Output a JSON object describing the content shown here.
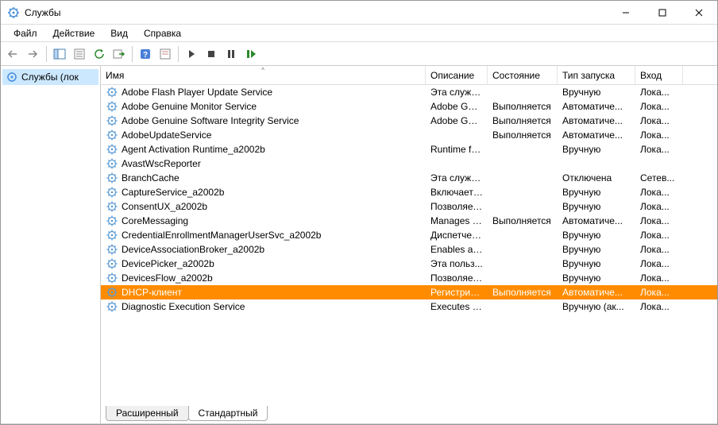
{
  "window": {
    "title": "Службы"
  },
  "menu": {
    "file": "Файл",
    "action": "Действие",
    "view": "Вид",
    "help": "Справка"
  },
  "tree": {
    "root": "Службы (лок"
  },
  "columns": {
    "name": "Имя",
    "description": "Описание",
    "state": "Состояние",
    "startup": "Тип запуска",
    "logon": "Вход "
  },
  "tabs": {
    "extended": "Расширенный",
    "standard": "Стандартный"
  },
  "services": [
    {
      "name": "Adobe Flash Player Update Service",
      "desc": "Эта служб...",
      "state": "",
      "startup": "Вручную",
      "logon": "Лока..."
    },
    {
      "name": "Adobe Genuine Monitor Service",
      "desc": "Adobe Gen...",
      "state": "Выполняется",
      "startup": "Автоматиче...",
      "logon": "Лока..."
    },
    {
      "name": "Adobe Genuine Software Integrity Service",
      "desc": "Adobe Gen...",
      "state": "Выполняется",
      "startup": "Автоматиче...",
      "logon": "Лока..."
    },
    {
      "name": "AdobeUpdateService",
      "desc": "",
      "state": "Выполняется",
      "startup": "Автоматиче...",
      "logon": "Лока..."
    },
    {
      "name": "Agent Activation Runtime_a2002b",
      "desc": "Runtime fo...",
      "state": "",
      "startup": "Вручную",
      "logon": "Лока..."
    },
    {
      "name": "AvastWscReporter",
      "desc": "",
      "state": "",
      "startup": "",
      "logon": ""
    },
    {
      "name": "BranchCache",
      "desc": "Эта служб...",
      "state": "",
      "startup": "Отключена",
      "logon": "Сетев..."
    },
    {
      "name": "CaptureService_a2002b",
      "desc": "Включает ...",
      "state": "",
      "startup": "Вручную",
      "logon": "Лока..."
    },
    {
      "name": "ConsentUX_a2002b",
      "desc": "Позволяет...",
      "state": "",
      "startup": "Вручную",
      "logon": "Лока..."
    },
    {
      "name": "CoreMessaging",
      "desc": "Manages c...",
      "state": "Выполняется",
      "startup": "Автоматиче...",
      "logon": "Лока..."
    },
    {
      "name": "CredentialEnrollmentManagerUserSvc_a2002b",
      "desc": "Диспетчер...",
      "state": "",
      "startup": "Вручную",
      "logon": "Лока..."
    },
    {
      "name": "DeviceAssociationBroker_a2002b",
      "desc": "Enables ap...",
      "state": "",
      "startup": "Вручную",
      "logon": "Лока..."
    },
    {
      "name": "DevicePicker_a2002b",
      "desc": "Эта польз...",
      "state": "",
      "startup": "Вручную",
      "logon": "Лока..."
    },
    {
      "name": "DevicesFlow_a2002b",
      "desc": "Позволяет...",
      "state": "",
      "startup": "Вручную",
      "logon": "Лока..."
    },
    {
      "name": "DHCP-клиент",
      "desc": "Регистрир...",
      "state": "Выполняется",
      "startup": "Автоматиче...",
      "logon": "Лока...",
      "selected": true
    },
    {
      "name": "Diagnostic Execution Service",
      "desc": "Executes di...",
      "state": "",
      "startup": "Вручную (ак...",
      "logon": "Лока..."
    }
  ]
}
